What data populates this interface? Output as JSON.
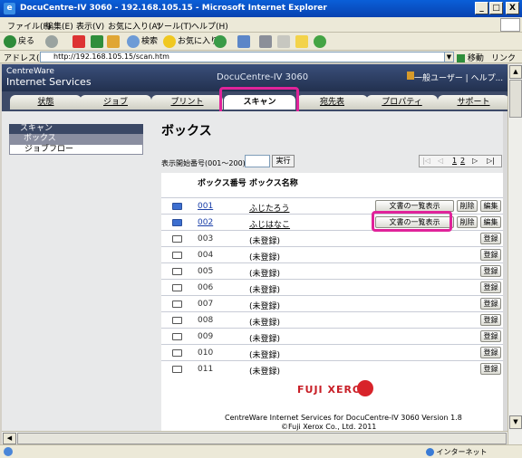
{
  "window": {
    "title": "DocuCentre-IV 3060 - 192.168.105.15 - Microsoft Internet Explorer",
    "minimize": "_",
    "maximize": "□",
    "close": "X"
  },
  "menu": [
    "ファイル(F)",
    "編集(E)",
    "表示(V)",
    "お気に入り(A)",
    "ツール(T)",
    "ヘルプ(H)"
  ],
  "toolbar": {
    "back": "戻る",
    "search": "検索",
    "favorites": "お気に入り"
  },
  "address": {
    "label": "アドレス(D)",
    "url": "http://192.168.105.15/scan.htm",
    "go": "移動",
    "links": "リンク"
  },
  "header": {
    "brand_line1": "CentreWare",
    "brand_line2": "Internet Services",
    "model": "DocuCentre-IV 3060",
    "user": "一般ユーザー | ヘルプ..."
  },
  "tabs": [
    "状態",
    "ジョブ",
    "プリント",
    "スキャン",
    "宛先表",
    "プロパティ",
    "サポート"
  ],
  "nav": {
    "heading": "スキャン",
    "items": [
      "ボックス",
      "ジョブフロー"
    ]
  },
  "main": {
    "title": "ボックス",
    "start_label": "表示開始番号(001～200)",
    "run": "実行",
    "pager": {
      "page": "1",
      "total": "2"
    },
    "col_number": "ボックス番号",
    "col_name": "ボックス名称",
    "rows": [
      {
        "num": "001",
        "name": "ふじたろう"
      },
      {
        "num": "002",
        "name": "ふじはなこ"
      },
      {
        "num": "003",
        "name": "(未登録)"
      },
      {
        "num": "004",
        "name": "(未登録)"
      },
      {
        "num": "005",
        "name": "(未登録)"
      },
      {
        "num": "006",
        "name": "(未登録)"
      },
      {
        "num": "007",
        "name": "(未登録)"
      },
      {
        "num": "008",
        "name": "(未登録)"
      },
      {
        "num": "009",
        "name": "(未登録)"
      },
      {
        "num": "010",
        "name": "(未登録)"
      },
      {
        "num": "011",
        "name": "(未登録)"
      }
    ],
    "btn_list": "文書の一覧表示",
    "btn_delete": "削除",
    "btn_edit": "編集",
    "btn_register": "登録"
  },
  "footer": {
    "logo": "FUJI XEROX",
    "line1": "CentreWare Internet Services for DocuCentre-IV 3060 Version 1.8",
    "line2": "©Fuji Xerox Co., Ltd. 2011"
  },
  "status": {
    "zone": "インターネット"
  },
  "colors": {
    "highlight": "#e0239a",
    "header": "#22314f",
    "brand_red": "#c81e26"
  }
}
